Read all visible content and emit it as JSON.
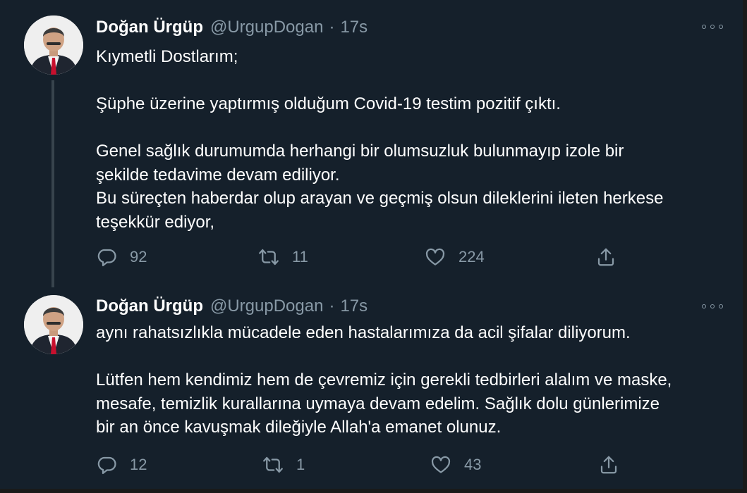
{
  "tweets": [
    {
      "author_name": "Doğan Ürgüp",
      "handle": "@UrgupDogan",
      "separator": "·",
      "time": "17s",
      "lines": [
        "Kıymetli Dostlarım;",
        "",
        "Şüphe üzerine yaptırmış olduğum Covid-19 testim pozitif çıktı.",
        "",
        "Genel sağlık durumumda herhangi bir olumsuzluk bulunmayıp izole bir",
        "şekilde tedavime devam ediliyor.",
        "Bu süreçten haberdar olup arayan ve geçmiş olsun dileklerini ileten herkese",
        "teşekkür ediyor,"
      ],
      "replies": "92",
      "retweets": "11",
      "likes": "224"
    },
    {
      "author_name": "Doğan Ürgüp",
      "handle": "@UrgupDogan",
      "separator": "·",
      "time": "17s",
      "lines": [
        "aynı rahatsızlıkla mücadele eden hastalarımıza da acil şifalar diliyorum.",
        "",
        "Lütfen hem kendimiz hem de çevremiz için gerekli tedbirleri alalım ve maske,",
        "mesafe, temizlik kurallarına uymaya devam edelim. Sağlık dolu günlerimize",
        "bir an önce kavuşmak dileğiyle Allah'a emanet olunuz."
      ],
      "replies": "12",
      "retweets": "1",
      "likes": "43"
    }
  ],
  "icons": {
    "reply": "speech-bubble-icon",
    "retweet": "retweet-icon",
    "like": "heart-icon",
    "share": "share-icon",
    "more": "more-dots-icon"
  },
  "colors": {
    "background": "#15202b",
    "text": "#ffffff",
    "secondary": "#8899a6",
    "thread_line": "#38444d"
  }
}
